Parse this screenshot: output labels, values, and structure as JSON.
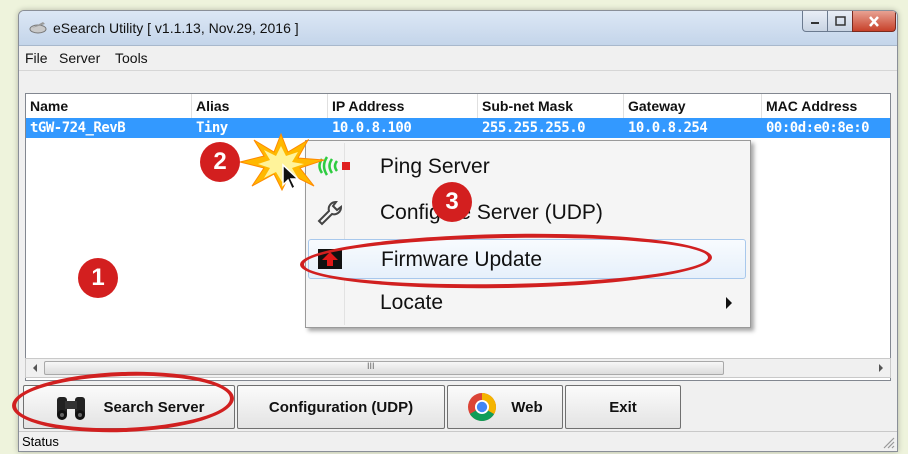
{
  "window": {
    "title": "eSearch Utility [ v1.1.13, Nov.29, 2016 ]"
  },
  "menubar": {
    "file": "File",
    "server": "Server",
    "tools": "Tools"
  },
  "table": {
    "columns": [
      "Name",
      "Alias",
      "IP Address",
      "Sub-net Mask",
      "Gateway",
      "MAC Address"
    ],
    "rows": [
      {
        "name": "tGW-724_RevB",
        "alias": "Tiny",
        "ip": "10.0.8.100",
        "mask": "255.255.255.0",
        "gateway": "10.0.8.254",
        "mac": "00:0d:e0:8e:0"
      }
    ]
  },
  "scrollbar": {
    "grip": "III"
  },
  "buttons": {
    "search": "Search Server",
    "config": "Configuration (UDP)",
    "web": "Web",
    "exit": "Exit"
  },
  "status": "Status",
  "context_menu": {
    "items": [
      {
        "label": "Ping Server",
        "icon": "ping-icon"
      },
      {
        "label": "Configure Server (UDP)",
        "icon": "wrench-icon"
      },
      {
        "label": "Firmware Update",
        "icon": "firmware-icon"
      },
      {
        "label": "Locate",
        "icon": "submenu-arrow-icon"
      }
    ]
  },
  "annotations": {
    "step1": "1",
    "step2": "2",
    "step3": "3"
  },
  "colors": {
    "selection": "#3399ff",
    "annotation_red": "#d12020"
  }
}
